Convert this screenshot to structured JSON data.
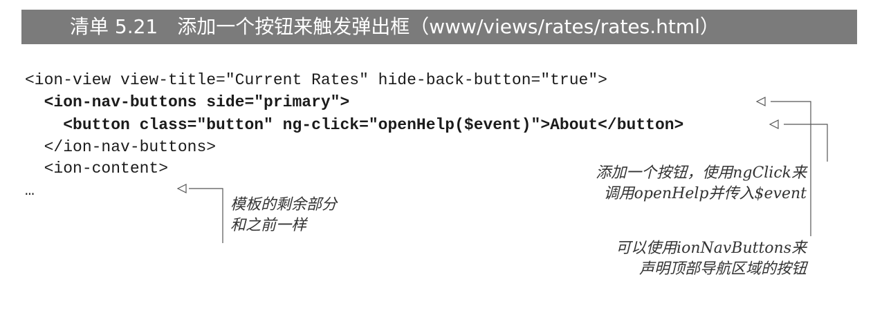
{
  "listing": {
    "label": "清单 5.21",
    "title": "添加一个按钮来触发弹出框（www/views/rates/rates.html）"
  },
  "code": {
    "line1": "<ion-view view-title=\"Current Rates\" hide-back-button=\"true\">",
    "line2": "  <ion-nav-buttons side=\"primary\">",
    "line3": "    <button class=\"button\" ng-click=\"openHelp($event)\">About</button>",
    "line4": "  </ion-nav-buttons>",
    "line5": "  <ion-content>",
    "line6": "…"
  },
  "annotations": {
    "template_rest": {
      "line1": "模板的剩余部分",
      "line2": "和之前一样"
    },
    "add_button": {
      "line1": "添加一个按钮，使用ngClick来",
      "line2": "调用openHelp并传入$event"
    },
    "nav_buttons": {
      "line1": "可以使用ionNavButtons来",
      "line2": "声明顶部导航区域的按钮"
    }
  }
}
